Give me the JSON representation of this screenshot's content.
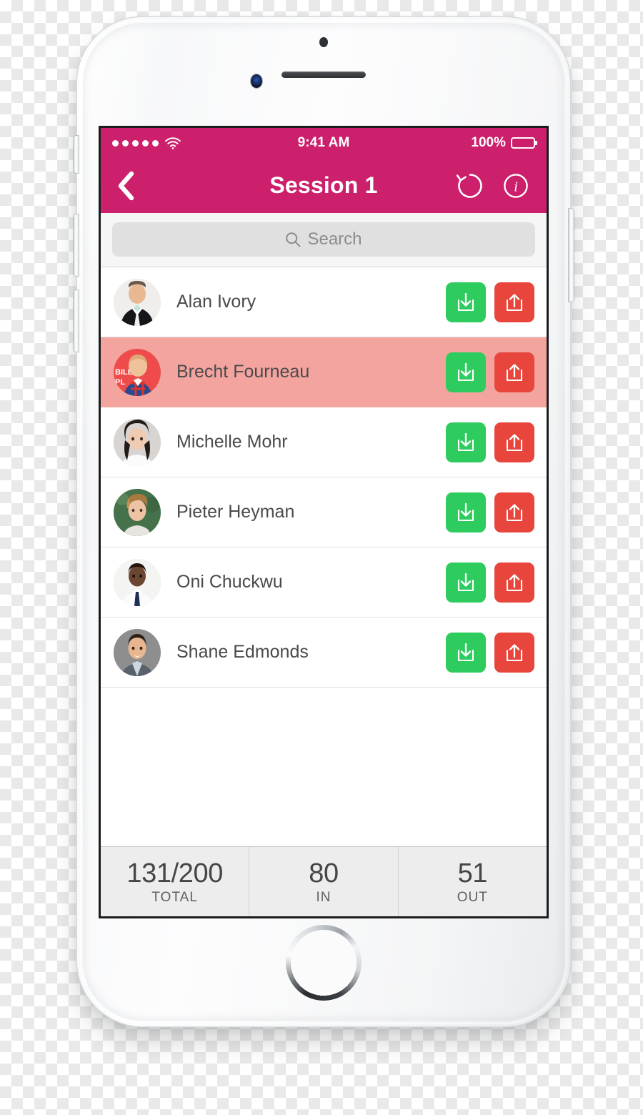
{
  "colors": {
    "brand": "#cc1f6c",
    "flagged_row": "#f4a49f",
    "check_in_green": "#2ecc5e",
    "check_out_red": "#e8453c",
    "screen_background": "#ffffff",
    "stats_background": "#ededed"
  },
  "status_bar": {
    "signal_dots": 5,
    "wifi": "wifi-icon",
    "time": "9:41 AM",
    "battery_percent": "100%",
    "battery_level": 100
  },
  "nav_bar": {
    "back_label": "back-chevron",
    "title": "Session 1",
    "actions": [
      {
        "name": "reset-icon",
        "label": "Reset"
      },
      {
        "name": "info-icon",
        "label": "Info"
      }
    ]
  },
  "search": {
    "placeholder": "Search",
    "value": "",
    "icon": "search-icon"
  },
  "list": {
    "action_in_icon": "arrow-down-into-tray-icon",
    "action_out_icon": "arrow-up-out-of-tray-icon",
    "action_in_label": "Check in",
    "action_out_label": "Check out",
    "attendees": [
      {
        "name": "Alan Ivory",
        "flagged": false,
        "avatar": "man-in-black-suit"
      },
      {
        "name": "Brecht Fourneau",
        "flagged": true,
        "avatar": "man-plaid-shirt-red-backdrop"
      },
      {
        "name": "Michelle Mohr",
        "flagged": false,
        "avatar": "woman-dark-hair"
      },
      {
        "name": "Pieter Heyman",
        "flagged": false,
        "avatar": "young-man-green-backdrop"
      },
      {
        "name": "Oni Chuckwu",
        "flagged": false,
        "avatar": "man-white-shirt-navy-tie"
      },
      {
        "name": "Shane Edmonds",
        "flagged": false,
        "avatar": "man-grey-backdrop"
      }
    ]
  },
  "stats": [
    {
      "value": "131/200",
      "label": "TOTAL"
    },
    {
      "value": "80",
      "label": "IN"
    },
    {
      "value": "51",
      "label": "OUT"
    }
  ]
}
